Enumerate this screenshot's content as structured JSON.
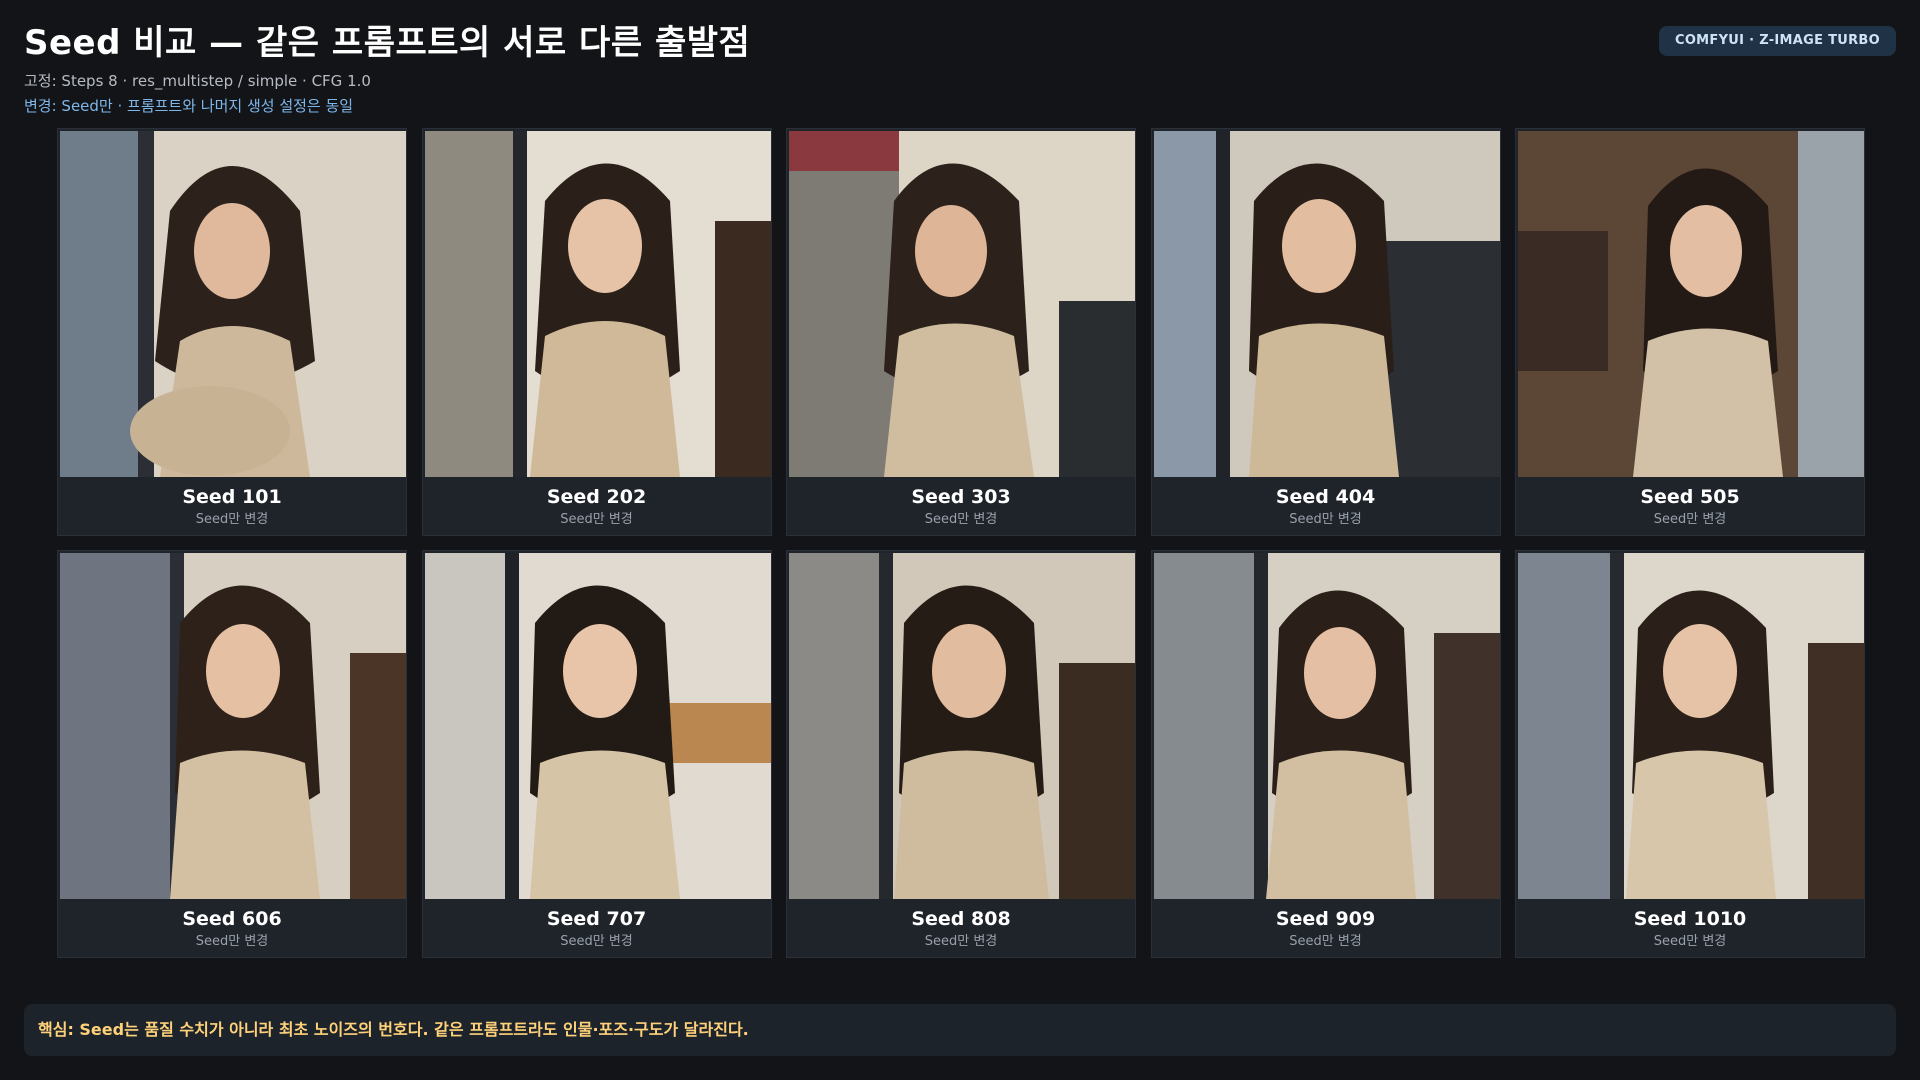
{
  "header": {
    "title": "Seed 비교 — 같은 프롬프트의 서로 다른 출발점",
    "subtitle": "고정: Steps 8 · res_multistep / simple · CFG 1.0",
    "changed": "변경: Seed만 · 프롬프트와 나머지 생성 설정은 동일",
    "badge": "COMFYUI · Z-IMAGE TURBO"
  },
  "cards": [
    {
      "title": "Seed 101",
      "sub": "Seed만 변경"
    },
    {
      "title": "Seed 202",
      "sub": "Seed만 변경"
    },
    {
      "title": "Seed 303",
      "sub": "Seed만 변경"
    },
    {
      "title": "Seed 404",
      "sub": "Seed만 변경"
    },
    {
      "title": "Seed 505",
      "sub": "Seed만 변경"
    },
    {
      "title": "Seed 606",
      "sub": "Seed만 변경"
    },
    {
      "title": "Seed 707",
      "sub": "Seed만 변경"
    },
    {
      "title": "Seed 808",
      "sub": "Seed만 변경"
    },
    {
      "title": "Seed 909",
      "sub": "Seed만 변경"
    },
    {
      "title": "Seed 1010",
      "sub": "Seed만 변경"
    }
  ],
  "footer": {
    "text": "핵심: Seed는 품질 수치가 아니라 최초 노이즈의 번호다. 같은 프롬프트라도 인물·포즈·구도가 달라진다."
  },
  "colors": {
    "background": "#121418",
    "card": "#1f242b",
    "accent_blue": "#7fb6ea",
    "badge_bg": "#203246",
    "footer_text": "#ffd27a"
  }
}
